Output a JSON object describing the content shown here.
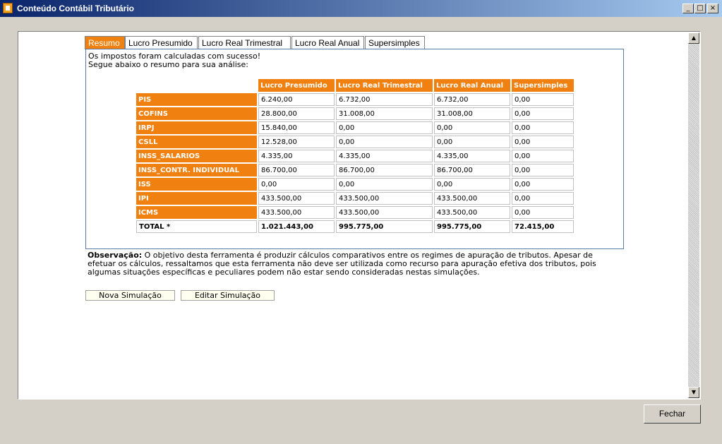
{
  "window": {
    "title": "Conteúdo Contábil Tributário",
    "minimize": "_",
    "maximize": "□",
    "close": "×"
  },
  "tabs": [
    "Resumo",
    "Lucro Presumido",
    "Lucro Real Trimestral",
    "Lucro Real Anual",
    "Supersimples"
  ],
  "message": {
    "line1": "Os impostos foram calculadas com sucesso!",
    "line2": "Segue abaixo o resumo para sua análise:"
  },
  "table": {
    "columns": [
      "Lucro Presumido",
      "Lucro Real Trimestral",
      "Lucro Real Anual",
      "Supersimples"
    ],
    "rows": [
      {
        "label": "PIS",
        "values": [
          "6.240,00",
          "6.732,00",
          "6.732,00",
          "0,00"
        ]
      },
      {
        "label": "COFINS",
        "values": [
          "28.800,00",
          "31.008,00",
          "31.008,00",
          "0,00"
        ]
      },
      {
        "label": "IRPJ",
        "values": [
          "15.840,00",
          "0,00",
          "0,00",
          "0,00"
        ]
      },
      {
        "label": "CSLL",
        "values": [
          "12.528,00",
          "0,00",
          "0,00",
          "0,00"
        ]
      },
      {
        "label": "INSS_SALARIOS",
        "values": [
          "4.335,00",
          "4.335,00",
          "4.335,00",
          "0,00"
        ]
      },
      {
        "label": "INSS_CONTR. INDIVIDUAL",
        "values": [
          "86.700,00",
          "86.700,00",
          "86.700,00",
          "0,00"
        ]
      },
      {
        "label": "ISS",
        "values": [
          "0,00",
          "0,00",
          "0,00",
          "0,00"
        ]
      },
      {
        "label": "IPI",
        "values": [
          "433.500,00",
          "433.500,00",
          "433.500,00",
          "0,00"
        ]
      },
      {
        "label": "ICMS",
        "values": [
          "433.500,00",
          "433.500,00",
          "433.500,00",
          "0,00"
        ]
      }
    ],
    "total": {
      "label": "TOTAL *",
      "values": [
        "1.021.443,00",
        "995.775,00",
        "995.775,00",
        "72.415,00"
      ]
    }
  },
  "observation": {
    "label": "Observação:",
    "text": " O objetivo desta ferramenta é produzir cálculos comparativos entre os regimes de apuração de tributos. Apesar de efetuar os cálculos, ressaltamos que esta ferramenta não deve ser utilizada como recurso para apuração efetiva dos tributos, pois algumas situações específicas e peculiares podem não estar sendo consideradas nestas simulações."
  },
  "buttons": {
    "nova": "Nova Simulação",
    "editar": "Editar Simulação",
    "fechar": "Fechar"
  },
  "colors": {
    "accent": "#f08010",
    "titlebar": "#0a246a"
  },
  "icons": {
    "app": "document-icon",
    "scroll_up": "arrow-up-icon",
    "scroll_down": "arrow-down-icon"
  }
}
